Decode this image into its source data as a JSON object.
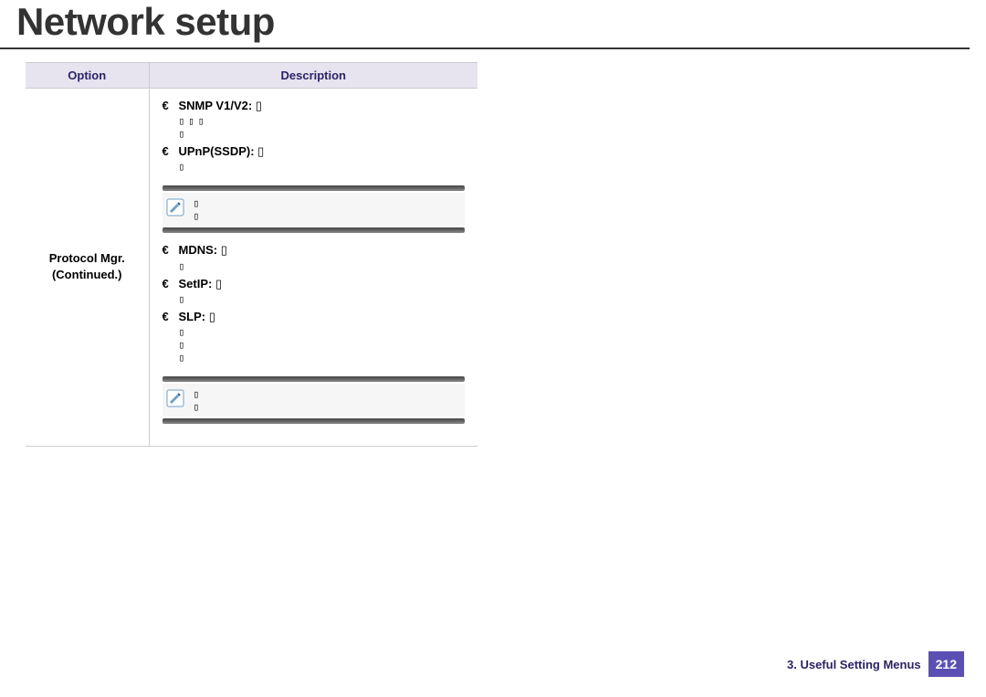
{
  "title": "Network setup",
  "table": {
    "headers": [
      "Option",
      "Description"
    ],
    "option_cell": {
      "line1": "Protocol Mgr.",
      "line2": "(Continued.)"
    },
    "items_group1": [
      {
        "label": "SNMP V1/V2:",
        "trail": " ▯",
        "extra": [
          "▯▯▯",
          "▯"
        ]
      },
      {
        "label": "UPnP(SSDP):",
        "trail": " ▯",
        "extra": [
          "▯"
        ]
      }
    ],
    "note1": {
      "l1": "▯",
      "l2": "▯"
    },
    "items_group2": [
      {
        "label": "MDNS:",
        "trail": " ▯",
        "extra": [
          "▯"
        ]
      },
      {
        "label": "SetIP:",
        "trail": " ▯",
        "extra": [
          "▯"
        ]
      },
      {
        "label": "SLP:",
        "trail": " ▯",
        "extra": [
          "▯",
          "▯",
          "▯"
        ]
      }
    ],
    "note2": {
      "l1": "▯",
      "l2": "▯"
    }
  },
  "footer": {
    "chapter": "3.  Useful Setting Menus",
    "page": "212"
  }
}
